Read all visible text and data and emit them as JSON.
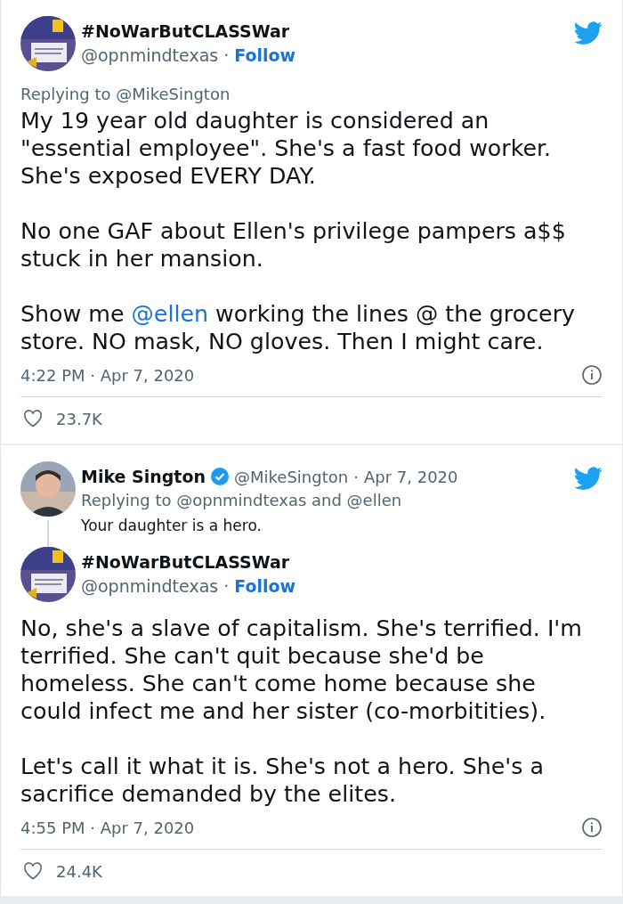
{
  "cards": [
    {
      "tweet": {
        "author": {
          "name": "#NoWarButCLASSWar",
          "handle": "@opnmindtexas"
        },
        "dot": "·",
        "follow": "Follow",
        "replying": "Replying to @MikeSington",
        "paragraphs": [
          [
            {
              "kind": "plain",
              "text": "My 19 year old daughter is considered an \"essential employee\". She's a fast food worker. She's exposed EVERY DAY."
            }
          ],
          [
            {
              "kind": "plain",
              "text": "No one GAF about Ellen's privilege pampers a$$ stuck in her mansion."
            }
          ],
          [
            {
              "kind": "plain",
              "text": "Show me "
            },
            {
              "kind": "mention",
              "text": "@ellen"
            },
            {
              "kind": "plain",
              "text": " working the lines @ the grocery store. NO mask, NO gloves. Then I might care."
            }
          ]
        ],
        "time": "4:22 PM · Apr 7, 2020",
        "likes": "23.7K"
      }
    },
    {
      "parent": {
        "author": {
          "name": "Mike Sington",
          "handle": "@MikeSington",
          "verified": true
        },
        "dot": "·",
        "date": "Apr 7, 2020",
        "replying": "Replying to @opnmindtexas and @ellen",
        "text": "Your daughter is a hero."
      },
      "tweet": {
        "author": {
          "name": "#NoWarButCLASSWar",
          "handle": "@opnmindtexas"
        },
        "dot": "·",
        "follow": "Follow",
        "paragraphs": [
          [
            {
              "kind": "plain",
              "text": "No, she's a slave of capitalism. She's terrified. I'm terrified. She can't quit because she'd be homeless. She can't come home because she could infect me and her sister (co-morbitities)."
            }
          ],
          [
            {
              "kind": "plain",
              "text": "Let's call it what it is. She's not a hero. She's a sacrifice demanded by the elites."
            }
          ]
        ],
        "time": "4:55 PM · Apr 7, 2020",
        "likes": "24.4K"
      }
    }
  ]
}
